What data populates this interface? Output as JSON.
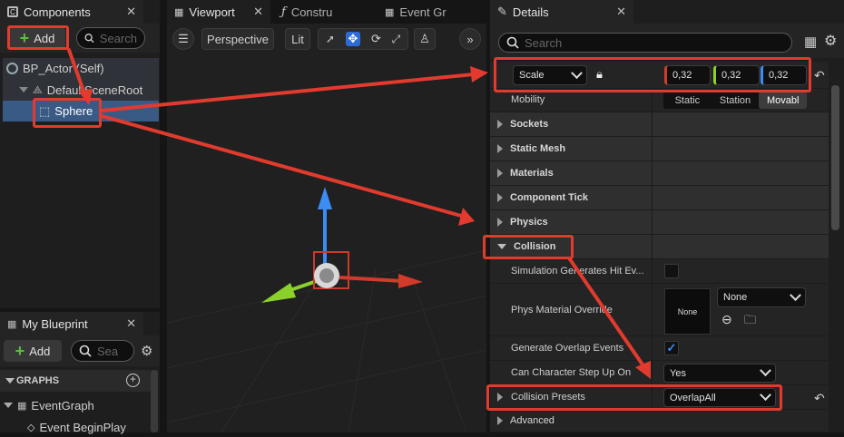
{
  "components_panel": {
    "tab_label": "Components",
    "add_label": "Add",
    "search_placeholder": "Search",
    "tree": [
      {
        "label": "BP_Actor (Self)"
      },
      {
        "label": "DefaultSceneRoot"
      },
      {
        "label": "Sphere"
      }
    ]
  },
  "my_blueprint": {
    "tab_label": "My Blueprint",
    "add_label": "Add",
    "search_placeholder": "Sea",
    "graphs_label": "GRAPHS",
    "items": [
      "EventGraph",
      "Event BeginPlay"
    ]
  },
  "tabs": {
    "viewport": "Viewport",
    "construction": "Constru",
    "event_graph": "Event Gr"
  },
  "viewport_toolbar": {
    "perspective": "Perspective",
    "lit": "Lit"
  },
  "details": {
    "tab_label": "Details",
    "search_placeholder": "Search",
    "scale": {
      "label": "Scale",
      "x": "0,32",
      "y": "0,32",
      "z": "0,32"
    },
    "mobility": {
      "label": "Mobility",
      "options": [
        "Static",
        "Station",
        "Movabl"
      ],
      "selected": "Movabl"
    },
    "categories": [
      "Sockets",
      "Static Mesh",
      "Materials",
      "Component Tick",
      "Physics"
    ],
    "collision": {
      "label": "Collision",
      "sim_hit_label": "Simulation Generates Hit Ev...",
      "sim_hit_checked": false,
      "phys_label": "Phys Material Override",
      "phys_thumb": "None",
      "phys_value": "None",
      "overlap_label": "Generate Overlap Events",
      "overlap_checked": true,
      "step_label": "Can Character Step Up On",
      "step_value": "Yes",
      "presets_label": "Collision Presets",
      "presets_value": "OverlapAll"
    },
    "advanced_label": "Advanced"
  },
  "colors": {
    "accent_blue": "#2f6bd6",
    "annotation_red": "#e23b2e",
    "x_red": "#d23a2a",
    "y_green": "#8bd12b",
    "z_blue": "#3b8cf3"
  }
}
